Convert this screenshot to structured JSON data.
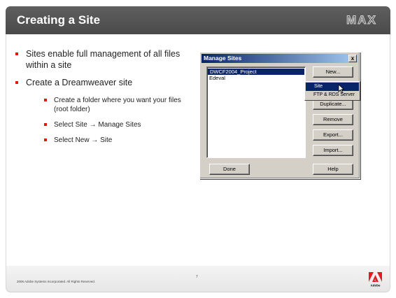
{
  "slide": {
    "title": "Creating a Site",
    "logo_text": "MAX",
    "bullets": [
      "Sites enable full management of all files within a site",
      "Create a Dreamweaver site"
    ],
    "sub_bullets": [
      "Create a folder where you want your files (root folder)",
      "Select Site → Manage Sites",
      "Select New → Site"
    ]
  },
  "dialog": {
    "title": "Manage Sites",
    "close_label": "x",
    "sites": [
      "DWCF2004_Project",
      "Edeval"
    ],
    "buttons": {
      "new": "New...",
      "duplicate": "Duplicate...",
      "remove": "Remove",
      "export": "Export...",
      "import": "Import...",
      "done": "Done",
      "help": "Help"
    },
    "new_menu": [
      "Site",
      "FTP & RDS Server"
    ]
  },
  "footer": {
    "copyright": "2006 Adobe Systems Incorporated.  All Rights Reserved.",
    "page_number": "7",
    "brand": "Adobe"
  },
  "colors": {
    "title_bar": "#555555",
    "bullet": "#d81e05",
    "selection": "#0a246a",
    "adobe_red": "#e21b23"
  },
  "icons": {
    "cursor": "arrow-cursor-icon",
    "brand": "adobe-logo-icon"
  }
}
